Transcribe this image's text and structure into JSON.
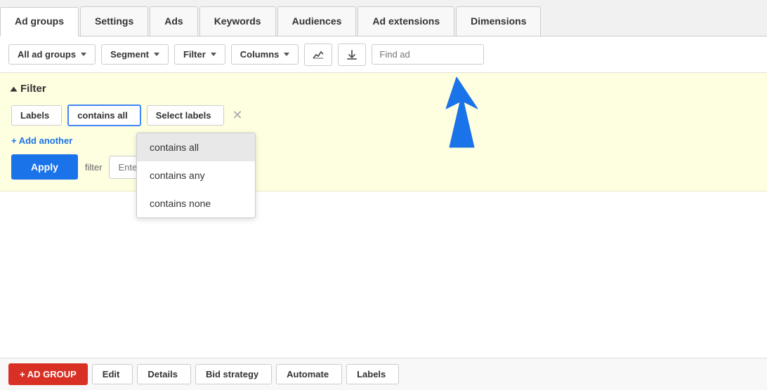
{
  "tabs": [
    {
      "label": "Ad groups",
      "active": true
    },
    {
      "label": "Settings",
      "active": false
    },
    {
      "label": "Ads",
      "active": false
    },
    {
      "label": "Keywords",
      "active": false
    },
    {
      "label": "Audiences",
      "active": false
    },
    {
      "label": "Ad extensions",
      "active": false
    },
    {
      "label": "Dimensions",
      "active": false
    }
  ],
  "toolbar": {
    "all_ad_groups_label": "All ad groups",
    "segment_label": "Segment",
    "filter_label": "Filter",
    "columns_label": "Columns",
    "find_placeholder": "Find ad"
  },
  "filter": {
    "section_title": "Filter",
    "labels_label": "Labels",
    "contains_all_label": "contains all",
    "select_labels_label": "Select labels",
    "add_another_label": "+ Add another",
    "apply_label": "Apply",
    "save_filter_label": "filter",
    "filter_name_placeholder": "Enter filter name"
  },
  "dropdown": {
    "items": [
      {
        "label": "contains all",
        "selected": true
      },
      {
        "label": "contains any",
        "selected": false
      },
      {
        "label": "contains none",
        "selected": false
      }
    ]
  },
  "bottom_bar": {
    "add_group_label": "+ AD GROUP",
    "edit_label": "Edit",
    "details_label": "Details",
    "bid_strategy_label": "Bid strategy",
    "automate_label": "Automate",
    "labels_label": "Labels"
  }
}
